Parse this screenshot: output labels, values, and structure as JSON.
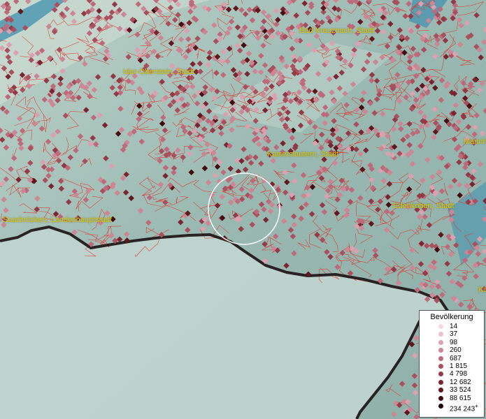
{
  "map": {
    "place_labels": [
      {
        "id": "bad-kreuznach",
        "text": "Bad Kreuznach, Stadt"
      },
      {
        "id": "idar-oberstein",
        "text": "Idar-Oberstein, Stadt"
      },
      {
        "id": "kaiserslautern",
        "text": "Kaiserslautern, Stadt"
      },
      {
        "id": "edenkoben",
        "text": "Edenkoben, Stadt"
      },
      {
        "id": "saarbruecken",
        "text": "Saarbrücken, Landeshauptstadt"
      },
      {
        "id": "mannheim-partial",
        "text": "Mannh"
      },
      {
        "id": "ka-partial",
        "text": "Ka"
      }
    ],
    "colors": {
      "land": "#9dbdb7",
      "lowland": "#c0d4cf",
      "boundaries": "#e0322c",
      "state_border": "#1a1212",
      "water": "#3f8fae"
    }
  },
  "legend": {
    "title": "Bevölkerung",
    "items": [
      {
        "label": "14",
        "color": "#f6d8e4"
      },
      {
        "label": "37",
        "color": "#ecc2cf"
      },
      {
        "label": "98",
        "color": "#dba1b0"
      },
      {
        "label": "260",
        "color": "#cc8695"
      },
      {
        "label": "687",
        "color": "#bd6b7c"
      },
      {
        "label": "1 815",
        "color": "#a9505f"
      },
      {
        "label": "4 798",
        "color": "#923a47"
      },
      {
        "label": "12 682",
        "color": "#7a2632"
      },
      {
        "label": "33 524",
        "color": "#601820"
      },
      {
        "label": "88 615",
        "color": "#420d12"
      },
      {
        "label": "234 243",
        "color": "#1a0406"
      }
    ],
    "open_end_marker": "+"
  }
}
